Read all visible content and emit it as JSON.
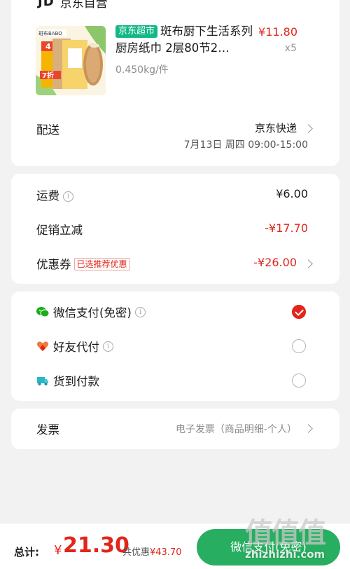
{
  "shop": {
    "logo": "JD",
    "name": "京东自营"
  },
  "product": {
    "tag": "京东超市",
    "title": "斑布厨下生活系列厨房纸巾 2层80节2…",
    "weight": "0.450kg/件",
    "price": "¥11.80",
    "qty": "x5",
    "image": {
      "brand": "斑布BABO",
      "badge_num": "4",
      "badge_sale": "7折"
    }
  },
  "delivery": {
    "label": "配送",
    "method": "京东快递",
    "time": "7月13日 周四 09:00-15:00"
  },
  "fees": {
    "shipping_label": "运费",
    "shipping_value": "¥6.00",
    "promo_label": "促销立减",
    "promo_value": "-¥17.70",
    "coupon_label": "优惠券",
    "coupon_tag": "已选推荐优惠",
    "coupon_value": "-¥26.00"
  },
  "payment": {
    "options": [
      {
        "label": "微信支付(免密)",
        "icon": "wechat-icon",
        "selected": true
      },
      {
        "label": "好友代付",
        "icon": "friend-pay-icon",
        "selected": false
      },
      {
        "label": "货到付款",
        "icon": "cod-truck-icon",
        "selected": false
      }
    ]
  },
  "invoice": {
    "label": "发票",
    "value": "电子发票（商品明细-个人）"
  },
  "footer": {
    "total_label": "总计:",
    "currency": "¥",
    "total_amount": "21.30",
    "discount_prefix": "共优惠",
    "discount_value": "¥43.70",
    "pay_button": "微信支付(免密)"
  },
  "watermark": {
    "glyphs": "值值值",
    "url": "zhizhizhi.com"
  },
  "colors": {
    "accent_red": "#e1251b",
    "pay_green": "#27ae60",
    "tag_green": "#12b886",
    "background": "#f2f2f2"
  }
}
